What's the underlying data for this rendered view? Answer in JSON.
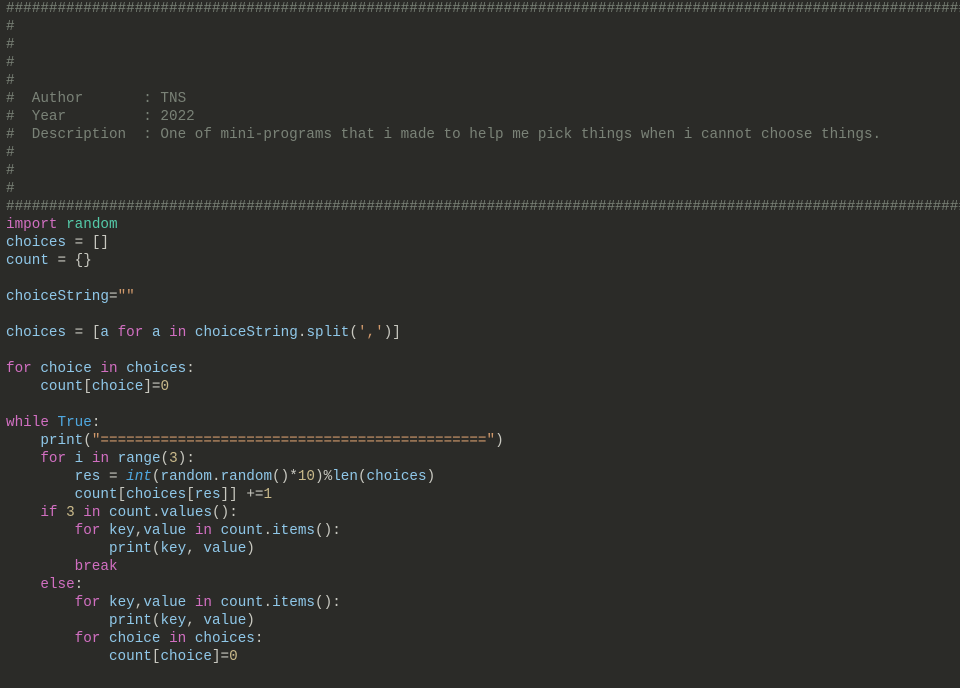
{
  "code": {
    "hr": "###################################################################################################################",
    "hash": "#",
    "authorLine": "#  Author       : TNS",
    "yearLine": "#  Year         : 2022",
    "descLine": "#  Description  : One of mini-programs that i made to help me pick things when i cannot choose things.",
    "kw_import": "import",
    "mod_random": "random",
    "id_choices": "choices",
    "id_count": "count",
    "id_choiceString": "choiceString",
    "id_choice": "choice",
    "id_key": "key",
    "id_value": "value",
    "id_a": "a",
    "id_i": "i",
    "id_res": "res",
    "kw_for": "for",
    "kw_in": "in",
    "kw_while": "while",
    "kw_if": "if",
    "kw_else": "else",
    "kw_break": "break",
    "bl_True": "True",
    "bl_int": "int",
    "bl_print": "print",
    "bl_range": "range",
    "bl_len": "len",
    "m_split": "split",
    "m_random": "random",
    "m_values": "values",
    "m_items": "items",
    "eq": " = ",
    "eq2": "=",
    "lbrack": "[",
    "rbrack": "]",
    "lbrace": "{",
    "rbrace": "}",
    "lparen": "(",
    "rparen": ")",
    "colon": ":",
    "comma": ",",
    "comma_sp": ", ",
    "dot": ".",
    "star": "*",
    "pct": "%",
    "pluseq": " +=",
    "empty2": "[]",
    "empty3": "{}",
    "s_empty": "\"\"",
    "s_comma": "','",
    "s_bar": "\"=============================================\"",
    "n0": "0",
    "n1": "1",
    "n3": "3",
    "n10": "10",
    "sp4": "    ",
    "sp8": "        ",
    "sp12": "            "
  }
}
